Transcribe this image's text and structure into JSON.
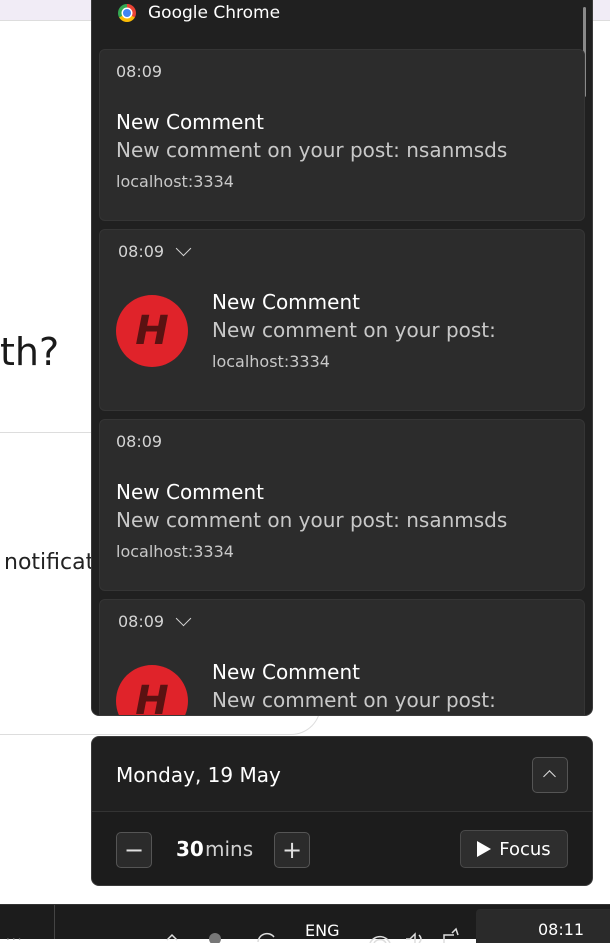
{
  "background_page": {
    "heading_fragment": "th?",
    "body_fragment": "notificat"
  },
  "notification_center": {
    "app_name": "Google Chrome",
    "notifications": [
      {
        "time": "08:09",
        "has_chevron": false,
        "title": "New Comment",
        "message": "New comment on your post: nsanmsds",
        "source": "localhost:3334",
        "has_avatar": false
      },
      {
        "time": "08:09",
        "has_chevron": true,
        "title": "New Comment",
        "message": "New comment on your post:",
        "source": "localhost:3334",
        "has_avatar": true,
        "avatar_letter": "H"
      },
      {
        "time": "08:09",
        "has_chevron": false,
        "title": "New Comment",
        "message": "New comment on your post: nsanmsds",
        "source": "localhost:3334",
        "has_avatar": false
      },
      {
        "time": "08:09",
        "has_chevron": true,
        "title": "New Comment",
        "message": "New comment on your post:",
        "has_avatar": true,
        "avatar_letter": "H"
      }
    ]
  },
  "calendar": {
    "date": "Monday, 19 May",
    "focus": {
      "minus_label": "−",
      "minutes_value": "30",
      "minutes_unit": "mins",
      "plus_label": "+",
      "focus_label": "Focus"
    }
  },
  "taskbar": {
    "language": "ENG",
    "time": "08:11"
  },
  "colors": {
    "panel_bg": "#202020",
    "card_bg": "#2c2c2c",
    "avatar_red": "#e0232a"
  }
}
